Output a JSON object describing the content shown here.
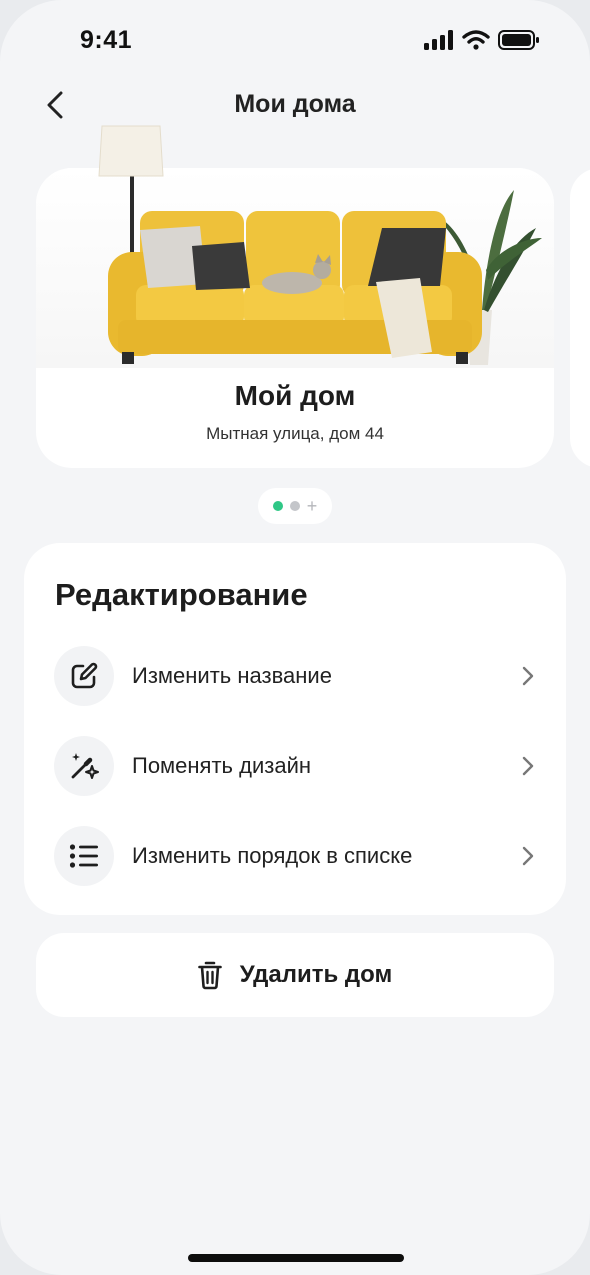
{
  "status_bar": {
    "time": "9:41"
  },
  "header": {
    "title": "Мои дома",
    "back_icon": "chevron-left-icon"
  },
  "home_card": {
    "name": "Мой дом",
    "address": "Мытная улица, дом 44",
    "colors": {
      "sofa": "#f1c232",
      "pillow_light": "#d8d6d2",
      "pillow_dark": "#3a3a3a"
    }
  },
  "pager": {
    "pages": 2,
    "active_index": 0,
    "add_symbol": "+",
    "active_color": "#2fc786"
  },
  "edit": {
    "title": "Редактирование",
    "items": [
      {
        "label": "Изменить название",
        "icon": "edit-icon"
      },
      {
        "label": "Поменять дизайн",
        "icon": "magic-wand-icon"
      },
      {
        "label": "Изменить порядок в списке",
        "icon": "list-icon"
      }
    ]
  },
  "delete": {
    "label": "Удалить дом",
    "icon": "trash-icon"
  }
}
